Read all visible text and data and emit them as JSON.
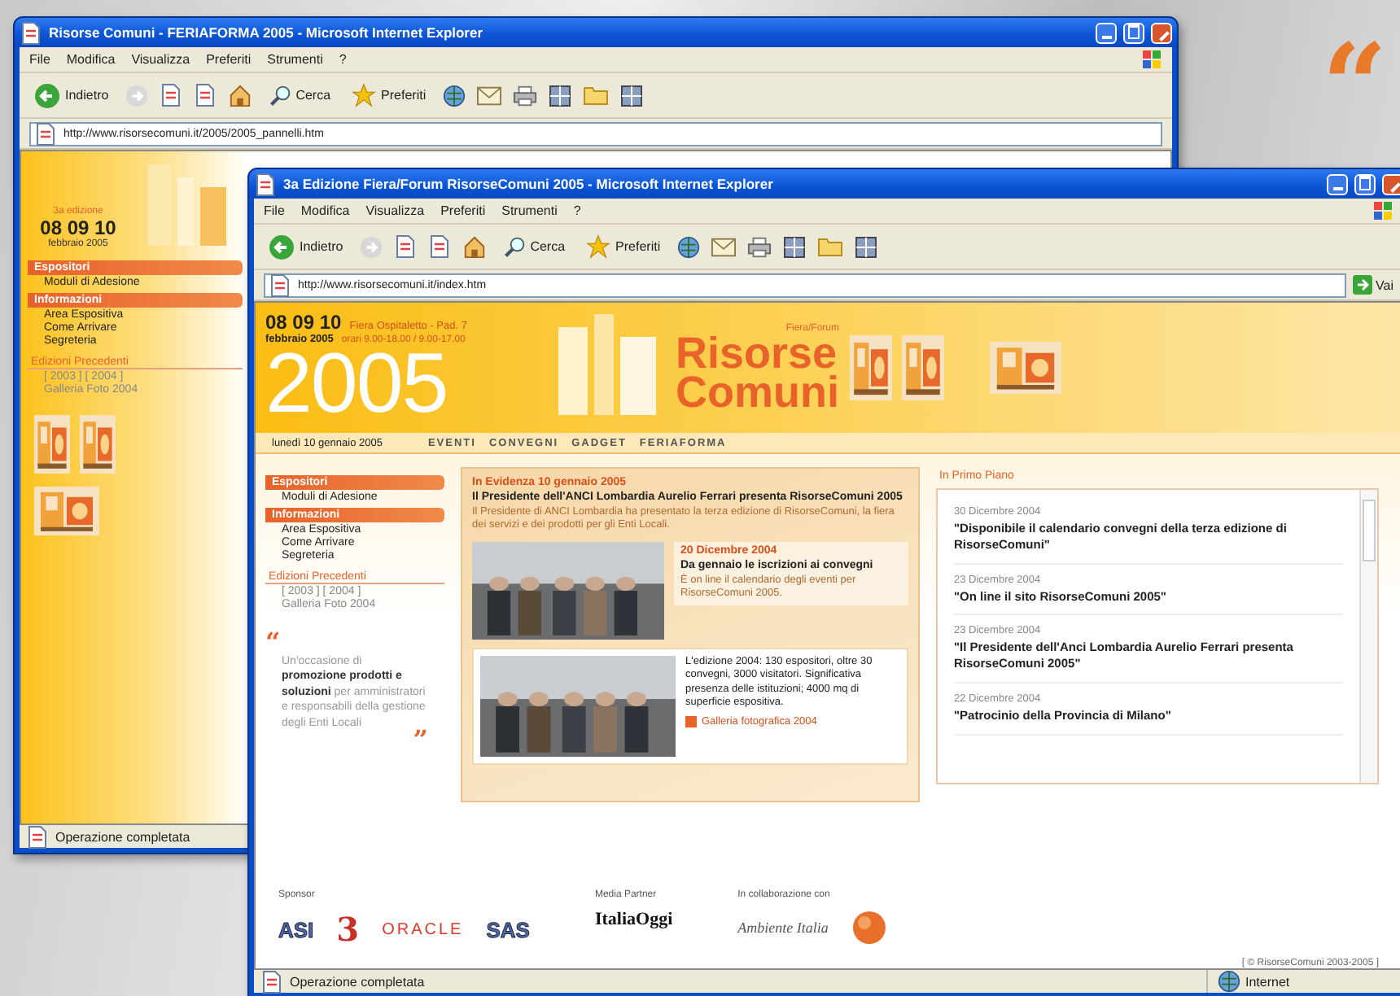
{
  "quote_mark": "“",
  "back_window": {
    "title": "Risorse Comuni - FERIAFORMA 2005 - Microsoft Internet Explorer",
    "menu": [
      "File",
      "Modifica",
      "Visualizza",
      "Preferiti",
      "Strumenti",
      "?"
    ],
    "toolbar": {
      "back": "Indietro",
      "search": "Cerca",
      "favorites": "Preferiti"
    },
    "address": {
      "url": "http://www.risorsecomuni.it/2005/2005_pannelli.htm"
    },
    "page": {
      "edition": "3a edizione",
      "dates": "08 09 10",
      "month": "febbraio 2005",
      "sections": [
        {
          "heading": "Espositori",
          "links": [
            "Moduli di Adesione"
          ]
        },
        {
          "heading": "Informazioni",
          "links": [
            "Area Espositiva",
            "Come Arrivare",
            "Segreteria"
          ]
        }
      ],
      "previous": {
        "heading": "Edizioni Precedenti",
        "links": [
          "[ 2003 ] [ 2004 ]",
          "Galleria Foto 2004"
        ]
      }
    },
    "status": "Operazione completata"
  },
  "front_window": {
    "title": "3a Edizione Fiera/Forum RisorseComuni 2005 - Microsoft Internet Explorer",
    "menu": [
      "File",
      "Modifica",
      "Visualizza",
      "Preferiti",
      "Strumenti",
      "?"
    ],
    "toolbar": {
      "back": "Indietro",
      "search": "Cerca",
      "favorites": "Preferiti"
    },
    "address": {
      "url": "http://www.risorsecomuni.it/index.htm",
      "go": "Vai"
    },
    "page": {
      "header": {
        "dates": "08 09 10",
        "venue": "Fiera Ospitaletto - Pad. 7",
        "month": "febbraio 2005",
        "hours": "orari 9.00-18.00 / 9.00-17.00",
        "year": "2005",
        "logo_small": "Fiera/Forum",
        "logo": [
          "Risorse",
          "Comuni"
        ]
      },
      "date_line": "lunedì 10 gennaio 2005",
      "nav": [
        "EVENTI",
        "CONVEGNI",
        "GADGET",
        "FERIAFORMA"
      ],
      "sections": [
        {
          "heading": "Espositori",
          "links": [
            "Moduli di Adesione"
          ]
        },
        {
          "heading": "Informazioni",
          "links": [
            "Area Espositiva",
            "Come Arrivare",
            "Segreteria"
          ]
        }
      ],
      "previous": {
        "heading": "Edizioni Precedenti",
        "links": [
          "[ 2003 ] [ 2004 ]",
          "Galleria Foto 2004"
        ]
      },
      "quote": {
        "open": "“",
        "text": "Un'occasione di **promozione prodotti e soluzioni** per amministratori e responsabili della gestione degli Enti Locali",
        "close": "”"
      },
      "highlight": {
        "kicker": "In Evidenza 10 gennaio 2005",
        "title": "Il Presidente dell'ANCI Lombardia Aurelio Ferrari presenta RisorseComuni 2005",
        "body": "Il Presidente di ANCI Lombardia ha presentato la terza edizione di RisorseComuni, la fiera dei servizi e dei prodotti per gli Enti Locali."
      },
      "news": {
        "kicker": "20 Dicembre 2004",
        "title": "Da gennaio le iscrizioni ai convegni",
        "body": "È on line il calendario degli eventi per RisorseComuni 2005."
      },
      "gallery": {
        "body": "L'edizione 2004: 130 espositori, oltre 30 convegni, 3000 visitatori. Significativa presenza delle istituzioni; 4000 mq di superficie espositiva.",
        "link": "Galleria fotografica 2004"
      },
      "side": {
        "heading": "In Primo Piano",
        "items": [
          {
            "date": "30 Dicembre 2004",
            "title": "\"Disponibile il calendario convegni della terza edizione di RisorseComuni\""
          },
          {
            "date": "23 Dicembre 2004",
            "title": "\"On line il sito RisorseComuni 2005\""
          },
          {
            "date": "23 Dicembre 2004",
            "title": "\"Il Presidente dell'Anci Lombardia Aurelio Ferrari presenta RisorseComuni 2005\""
          },
          {
            "date": "22 Dicembre 2004",
            "title": "\"Patrocinio della Provincia di Milano\""
          }
        ]
      },
      "footer": [
        {
          "heading": "Sponsor",
          "logos": [
            {
              "kind": "outline",
              "text": "ASI"
            },
            {
              "kind": "numeral",
              "text": "3"
            },
            {
              "kind": "spaced",
              "text": "ORACLE"
            },
            {
              "kind": "outline",
              "text": "SAS"
            }
          ]
        },
        {
          "heading": "Media Partner",
          "logos": [
            {
              "kind": "heavy",
              "text": "ItaliaOggi"
            }
          ]
        },
        {
          "heading": "In collaborazione con",
          "logos": [
            {
              "kind": "script",
              "text": "Ambiente Italia"
            },
            {
              "kind": "emblem"
            }
          ]
        }
      ],
      "copyright": "[ © RisorseComuni 2003-2005 ]"
    },
    "status": "Operazione completata",
    "zone": "Internet"
  }
}
